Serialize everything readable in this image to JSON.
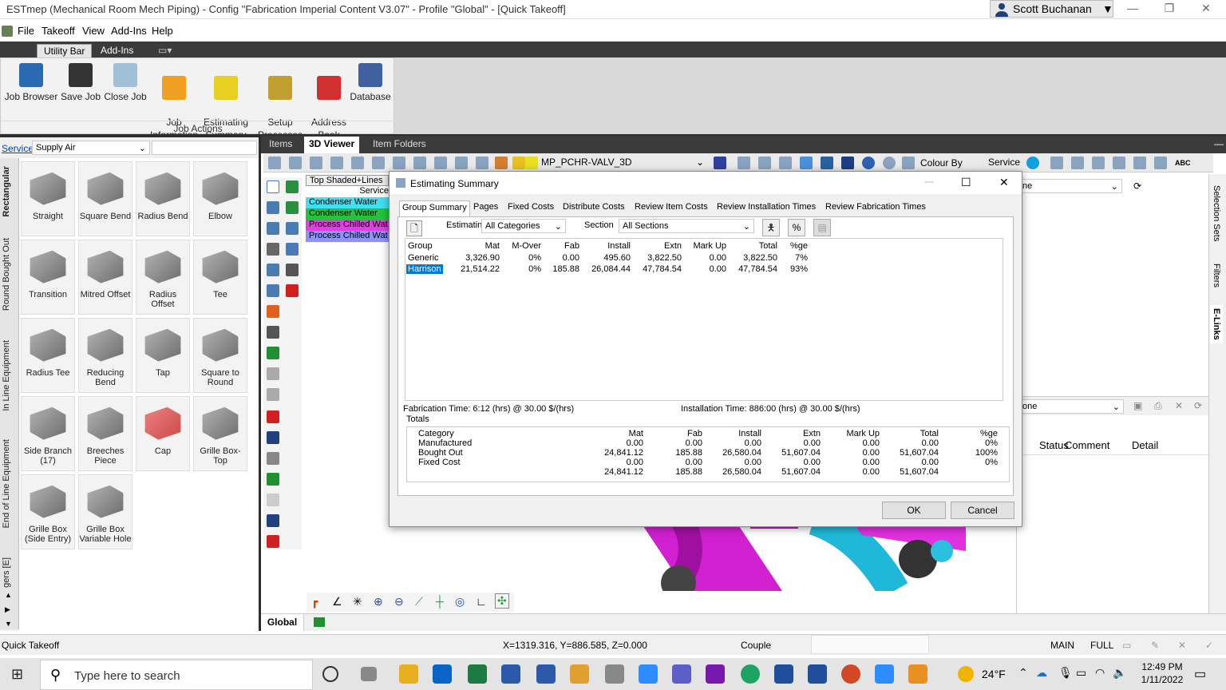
{
  "titlebar": {
    "title": "ESTmep (Mechanical Room Mech Piping) - Config \"Fabrication Imperial Content V3.07\" - Profile \"Global\" - [Quick Takeoff]",
    "user": "Scott Buchanan",
    "minimize": "—",
    "restore": "❐",
    "close": "✕"
  },
  "menu": [
    "File",
    "Takeoff",
    "View",
    "Add-Ins",
    "Help"
  ],
  "ribbon_tabs": [
    "Utility Bar",
    "Add-Ins"
  ],
  "ribbon": {
    "buttons": [
      "Job Browser",
      "Save Job",
      "Close Job",
      "Job\nInformation",
      "Estimating\nSummary",
      "Setup\nProcesses",
      "Address\nBook",
      "Database"
    ],
    "group_label": "Job Actions"
  },
  "service": {
    "label": "Service",
    "value": "Supply Air"
  },
  "vtabs": [
    "Rectangular",
    "Round Bought Out",
    "In Line Equipment",
    "End of Line Equipment",
    "gers [E]"
  ],
  "palette": [
    "Straight",
    "Square Bend",
    "Radius Bend",
    "Elbow",
    "Transition",
    "Mitred Offset",
    "Radius Offset",
    "Tee",
    "Radius Tee",
    "Reducing Bend",
    "Tap",
    "Square to Round",
    "Side Branch (17)",
    "Breeches Piece",
    "Cap",
    "Grille Box-Top",
    "Grille Box (Side Entry)",
    "Grille Box Variable Hole"
  ],
  "viewer_tabs": [
    "Items",
    "3D Viewer",
    "Item Folders"
  ],
  "viewer_toolbar": {
    "view_name": "MP_PCHR-VALV_3D",
    "colour_by": "Colour By",
    "service": "Service",
    "abc": "ABC"
  },
  "legend": {
    "header1": "Top Shaded+Lines",
    "header2": "Service",
    "items": [
      "Condenser Water",
      "Condenser Water",
      "Process Chilled Wat",
      "Process Chilled Wat"
    ],
    "colors": [
      "#40e0f0",
      "#22c43a",
      "#e040e0",
      "#9090ff"
    ]
  },
  "right_panel": {
    "combo1": "ne",
    "combo2": "one",
    "cols": [
      "Status",
      "Comment",
      "Detail"
    ],
    "side_tabs": [
      "Selection Sets",
      "Filters",
      "E-Links"
    ]
  },
  "dialog": {
    "title": "Estimating Summary",
    "tabs": [
      "Group Summary",
      "Pages",
      "Fixed Costs",
      "Distribute Costs",
      "Review Item Costs",
      "Review Installation Times",
      "Review Fabrication Times"
    ],
    "estimating_label": "Estimating",
    "estimating_value": "All Categories",
    "section_label": "Section",
    "section_value": "All Sections",
    "group_headers": [
      "Group",
      "Mat",
      "M-Over",
      "Fab",
      "Install",
      "Extn",
      "Mark Up",
      "Total",
      "%ge"
    ],
    "group_rows": [
      [
        "Generic",
        "3,326.90",
        "0%",
        "0.00",
        "495.60",
        "3,822.50",
        "0.00",
        "3,822.50",
        "7%"
      ],
      [
        "Harrison",
        "21,514.22",
        "0%",
        "185.88",
        "26,084.44",
        "47,784.54",
        "0.00",
        "47,784.54",
        "93%"
      ]
    ],
    "fab_time": "Fabrication Time: 6:12 (hrs) @ 30.00 $/(hrs)",
    "install_time": "Installation Time: 886:00 (hrs) @ 30.00 $/(hrs)",
    "totals_label": "Totals",
    "totals_headers": [
      "Category",
      "Mat",
      "Fab",
      "Install",
      "Extn",
      "Mark Up",
      "Total",
      "%ge"
    ],
    "totals_rows": [
      [
        "Manufactured",
        "0.00",
        "0.00",
        "0.00",
        "0.00",
        "0.00",
        "0.00",
        "0%"
      ],
      [
        "Bought Out",
        "24,841.12",
        "185.88",
        "26,580.04",
        "51,607.04",
        "0.00",
        "51,607.04",
        "100%"
      ],
      [
        "Fixed Cost",
        "0.00",
        "0.00",
        "0.00",
        "0.00",
        "0.00",
        "0.00",
        "0%"
      ],
      [
        "",
        "24,841.12",
        "185.88",
        "26,580.04",
        "51,607.04",
        "0.00",
        "51,607.04",
        ""
      ]
    ],
    "ok": "OK",
    "cancel": "Cancel"
  },
  "global_tab": "Global",
  "status": {
    "left": "Quick Takeoff",
    "coords": "X=1319.316, Y=886.585, Z=0.000",
    "mode": "Couple",
    "main": "MAIN",
    "full": "FULL"
  },
  "taskbar": {
    "search": "Type here to search",
    "weather": "24°F",
    "time": "12:49 PM",
    "date": "1/11/2022"
  }
}
